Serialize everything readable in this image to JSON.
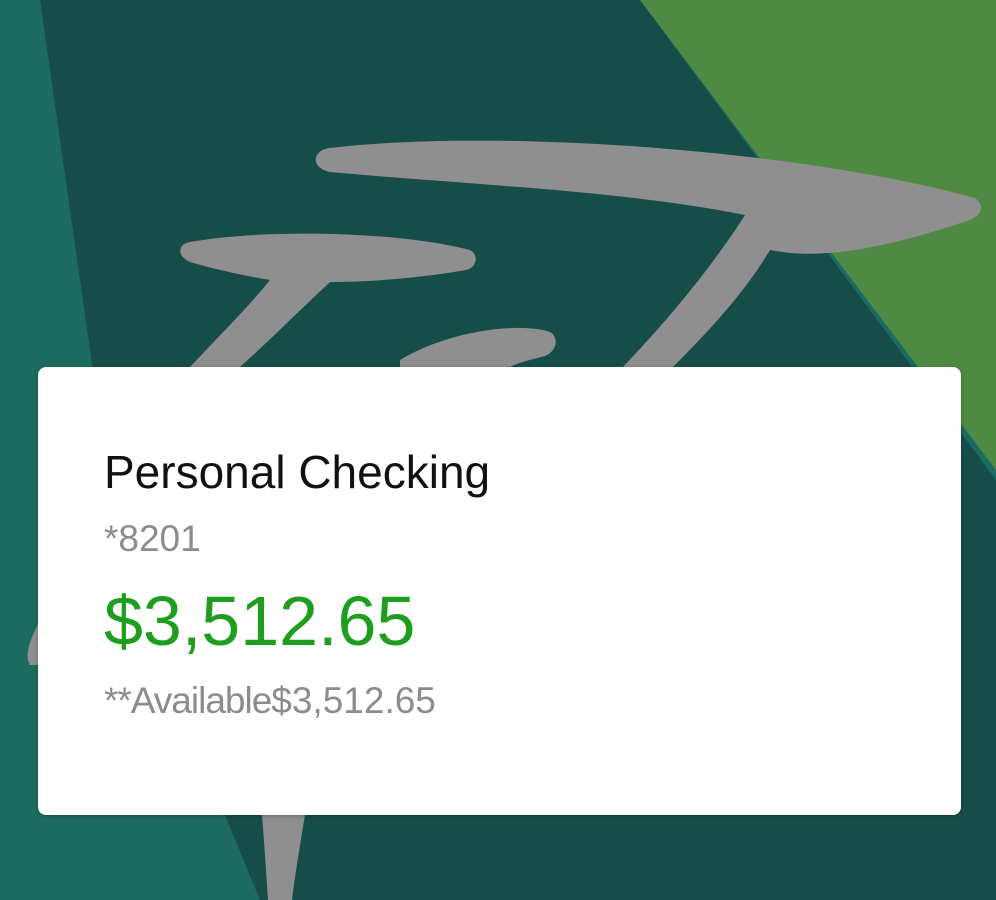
{
  "colors": {
    "background_dark": "#174a45",
    "background_teal": "#1b6b60",
    "background_green": "#4e8a45",
    "logo_gray": "#8f8f8f",
    "card_background": "#ffffff",
    "balance_green": "#1e9d1e",
    "secondary_text": "#8c8c8c"
  },
  "background": {
    "logo_icon": "bank-arrows-logo"
  },
  "account_card": {
    "name": "Personal Checking",
    "number": "*8201",
    "balance": "$3,512.65",
    "available_label": "**Available",
    "available_amount": "$3,512.65"
  }
}
